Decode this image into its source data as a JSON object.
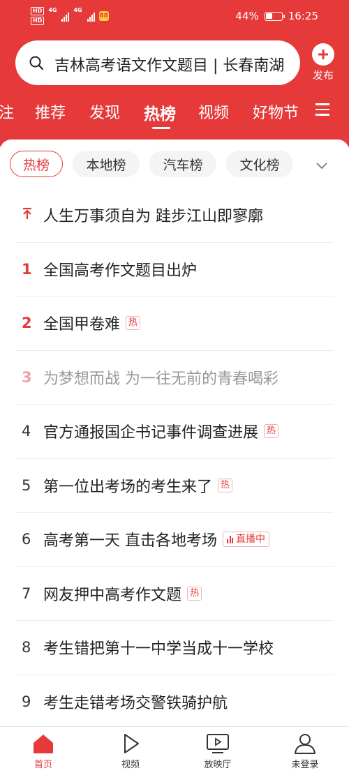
{
  "status_bar": {
    "hd1": "HD",
    "hd2": "HD",
    "net1": "4G",
    "net2": "4G",
    "battery_text": "44%",
    "battery_level": 0.44,
    "time": "16:25",
    "app_badge": "88"
  },
  "search": {
    "text": "吉林高考语文作文题目 | 长春南湖"
  },
  "publish": {
    "label": "发布"
  },
  "tabs": [
    {
      "label": "注"
    },
    {
      "label": "推荐"
    },
    {
      "label": "发现"
    },
    {
      "label": "热榜",
      "active": true
    },
    {
      "label": "视频"
    },
    {
      "label": "好物节"
    }
  ],
  "subtabs": [
    {
      "label": "热榜",
      "active": true
    },
    {
      "label": "本地榜"
    },
    {
      "label": "汽车榜"
    },
    {
      "label": "文化榜"
    }
  ],
  "list": [
    {
      "rank": "",
      "title": "人生万事须自为 跬步江山即寥廓",
      "pinned": true
    },
    {
      "rank": "1",
      "title": "全国高考作文题目出炉"
    },
    {
      "rank": "2",
      "title": "全国甲卷难",
      "badge": "热"
    },
    {
      "rank": "3",
      "title": "为梦想而战 为一往无前的青春喝彩"
    },
    {
      "rank": "4",
      "title": "官方通报国企书记事件调查进展",
      "badge": "热"
    },
    {
      "rank": "5",
      "title": "第一位出考场的考生来了",
      "badge": "热"
    },
    {
      "rank": "6",
      "title": "高考第一天 直击各地考场",
      "live_badge": "直播中"
    },
    {
      "rank": "7",
      "title": "网友押中高考作文题",
      "badge": "热"
    },
    {
      "rank": "8",
      "title": "考生错把第十一中学当成十一学校"
    },
    {
      "rank": "9",
      "title": "考生走错考场交警铁骑护航"
    }
  ],
  "bottom_nav": [
    {
      "label": "首页",
      "icon": "home-icon",
      "active": true
    },
    {
      "label": "视频",
      "icon": "play-icon"
    },
    {
      "label": "放映厅",
      "icon": "screen-icon"
    },
    {
      "label": "未登录",
      "icon": "user-icon"
    }
  ],
  "colors": {
    "accent": "#e5393a",
    "badge_border": "#f1b3b3"
  }
}
